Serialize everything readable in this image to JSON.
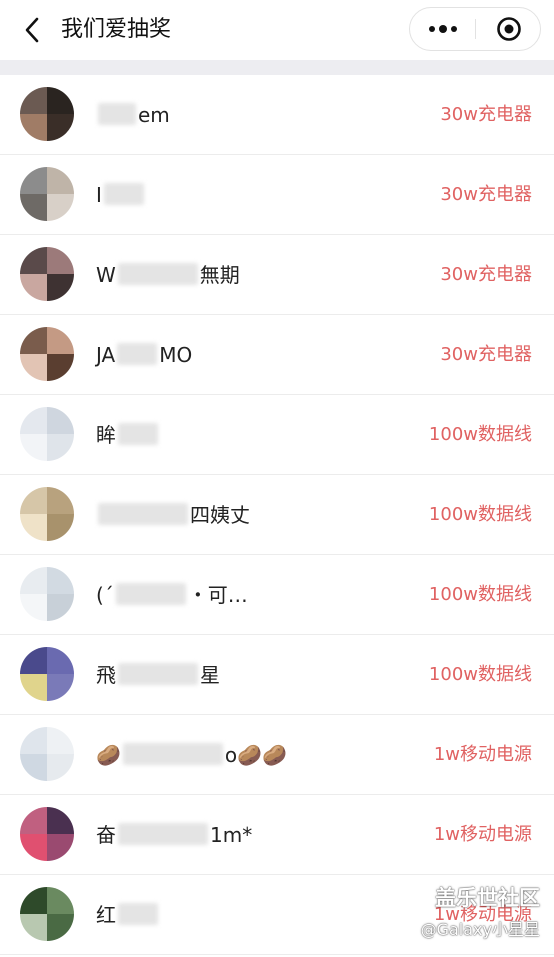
{
  "navbar": {
    "back_icon": "chevron-left-icon",
    "title": "我们爱抽奖",
    "menu_icon": "more-dots-icon",
    "close_icon": "target-circle-icon"
  },
  "winners": [
    {
      "name_parts": [
        "",
        "em"
      ],
      "prize": "30w充电器"
    },
    {
      "name_parts": [
        "I",
        ""
      ],
      "prize": "30w充电器"
    },
    {
      "name_parts": [
        "W",
        "無期"
      ],
      "prize": "30w充电器"
    },
    {
      "name_parts": [
        "JA",
        "MO"
      ],
      "prize": "30w充电器"
    },
    {
      "name_parts": [
        "眸",
        ""
      ],
      "prize": "100w数据线"
    },
    {
      "name_parts": [
        "",
        "四姨丈"
      ],
      "prize": "100w数据线"
    },
    {
      "name_parts": [
        "(´",
        "・可…"
      ],
      "prize": "100w数据线"
    },
    {
      "name_parts": [
        "飛",
        "星"
      ],
      "prize": "100w数据线"
    },
    {
      "name_parts": [
        "🥔",
        "o🥔🥔"
      ],
      "prize": "1w移动电源"
    },
    {
      "name_parts": [
        "奋",
        "1m*"
      ],
      "prize": "1w移动电源"
    },
    {
      "name_parts": [
        "红",
        ""
      ],
      "prize": "1w移动电源"
    }
  ],
  "watermark": {
    "logo": "盖乐世社区",
    "sub": "@Galaxy小星星"
  }
}
